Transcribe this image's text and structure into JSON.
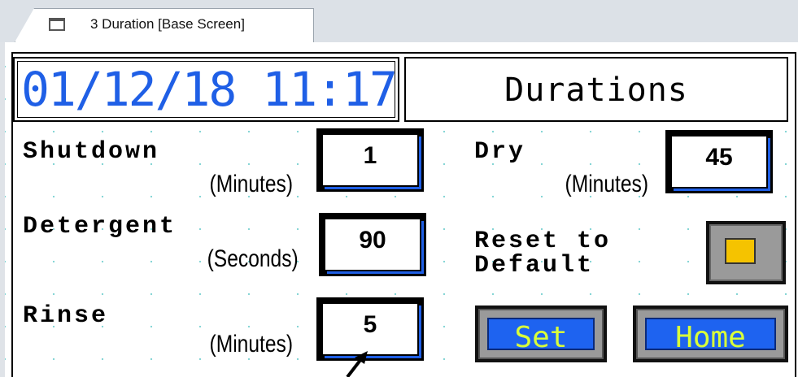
{
  "tab": {
    "label": "3 Duration [Base Screen]"
  },
  "header": {
    "datetime": "01/12/18 11:17",
    "title": "Durations"
  },
  "fields": {
    "shutdown": {
      "label": "Shutdown",
      "unit": "(Minutes)",
      "value": "1"
    },
    "detergent": {
      "label": "Detergent",
      "unit": "(Seconds)",
      "value": "90"
    },
    "rinse": {
      "label": "Rinse",
      "unit": "(Minutes)",
      "value": "5"
    },
    "dry": {
      "label": "Dry",
      "unit": "(Minutes)",
      "value": "45"
    }
  },
  "reset": {
    "label_line1": "Reset to",
    "label_line2": "Default",
    "indicator_color": "#f5c300"
  },
  "buttons": {
    "set_label": "Set",
    "home_label": "Home"
  },
  "colors": {
    "accent_blue": "#1f5fe6",
    "button_text": "#d9ff3a"
  },
  "icons": {
    "tab_icon": "window-icon",
    "pointer": "arrow-cursor-icon"
  }
}
